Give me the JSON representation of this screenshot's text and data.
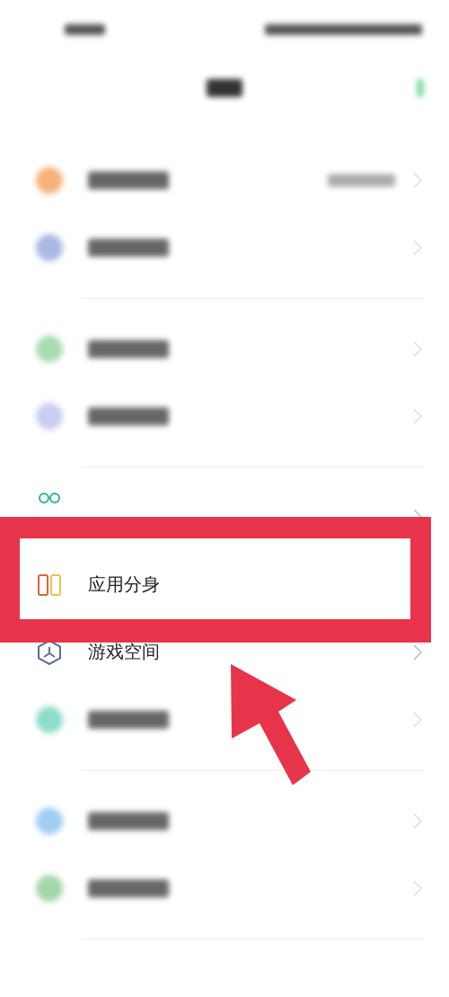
{
  "sections": [
    {
      "items": [
        {
          "kind": "blurred",
          "color": "#f6b27a",
          "has_value": true
        },
        {
          "kind": "blurred",
          "color": "#aab8e6",
          "has_value": false
        }
      ]
    },
    {
      "items": [
        {
          "kind": "blurred",
          "color": "#a9dcb0",
          "has_value": false
        },
        {
          "kind": "blurred",
          "color": "#c9cdef",
          "has_value": false
        }
      ]
    },
    {
      "items": [
        {
          "kind": "apps"
        },
        {
          "kind": "clone",
          "label": "应用分身"
        },
        {
          "kind": "game",
          "label": "游戏空间"
        },
        {
          "kind": "blurred",
          "color": "#8edccb",
          "has_value": false
        }
      ]
    },
    {
      "items": [
        {
          "kind": "blurred",
          "color": "#9fcdf3",
          "has_value": false
        },
        {
          "kind": "blurred",
          "color": "#a5d6a9",
          "has_value": false
        }
      ]
    }
  ]
}
